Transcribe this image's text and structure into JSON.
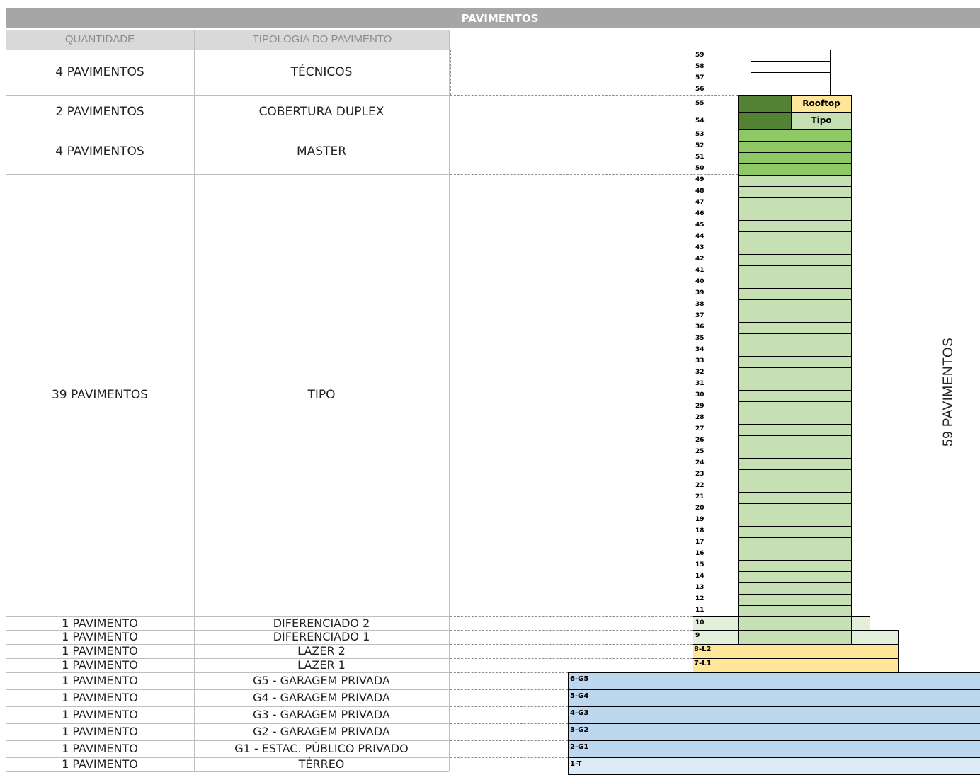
{
  "title": "PAVIMENTOS",
  "headers": {
    "quantity": "QUANTIDADE",
    "typology": "TIPOLOGIA DO PAVIMENTO"
  },
  "rows": [
    {
      "quantity": "4 PAVIMENTOS",
      "typology": "TÉCNICOS"
    },
    {
      "quantity": "2 PAVIMENTOS",
      "typology": "COBERTURA DUPLEX"
    },
    {
      "quantity": "4 PAVIMENTOS",
      "typology": "MASTER"
    },
    {
      "quantity": "39 PAVIMENTOS",
      "typology": "TIPO"
    },
    {
      "quantity": "1 PAVIMENTO",
      "typology": "DIFERENCIADO 2"
    },
    {
      "quantity": "1 PAVIMENTO",
      "typology": "DIFERENCIADO 1"
    },
    {
      "quantity": "1 PAVIMENTO",
      "typology": "LAZER 2"
    },
    {
      "quantity": "1 PAVIMENTO",
      "typology": "LAZER 1"
    },
    {
      "quantity": "1 PAVIMENTO",
      "typology": "G5 - GARAGEM PRIVADA"
    },
    {
      "quantity": "1 PAVIMENTO",
      "typology": "G4 - GARAGEM PRIVADA"
    },
    {
      "quantity": "1 PAVIMENTO",
      "typology": "G3 - GARAGEM PRIVADA"
    },
    {
      "quantity": "1 PAVIMENTO",
      "typology": "G2 - GARAGEM PRIVADA"
    },
    {
      "quantity": "1 PAVIMENTO",
      "typology": "G1 - ESTAC. PÚBLICO PRIVADO"
    },
    {
      "quantity": "1 PAVIMENTO",
      "typology": "TÉRREO"
    }
  ],
  "building": {
    "floor_numbers": [
      "59",
      "58",
      "57",
      "56",
      "55",
      "54",
      "53",
      "52",
      "51",
      "50",
      "49",
      "48",
      "47",
      "46",
      "45",
      "44",
      "43",
      "42",
      "41",
      "40",
      "39",
      "38",
      "37",
      "36",
      "35",
      "34",
      "33",
      "32",
      "31",
      "30",
      "29",
      "28",
      "27",
      "26",
      "25",
      "24",
      "23",
      "22",
      "21",
      "20",
      "19",
      "18",
      "17",
      "16",
      "15",
      "14",
      "13",
      "12",
      "11",
      "10",
      "9"
    ],
    "rooftop_label": "Rooftop",
    "tipo_label": "Tipo",
    "podium_labels": [
      "8-L2",
      "7-L1"
    ],
    "garage_labels": [
      "6-G5",
      "5-G4",
      "4-G3",
      "3-G2",
      "2-G1",
      "1-T"
    ],
    "colors": {
      "technical": "#ffffff",
      "duplex_dark": "#548235",
      "master": "#8fc965",
      "tipo": "#c6e0b4",
      "differentiated": "#e2efda",
      "leisure": "#ffe699",
      "garage": "#bdd7ee",
      "ground": "#ddebf7"
    }
  },
  "total_label": "59 PAVIMENTOS"
}
